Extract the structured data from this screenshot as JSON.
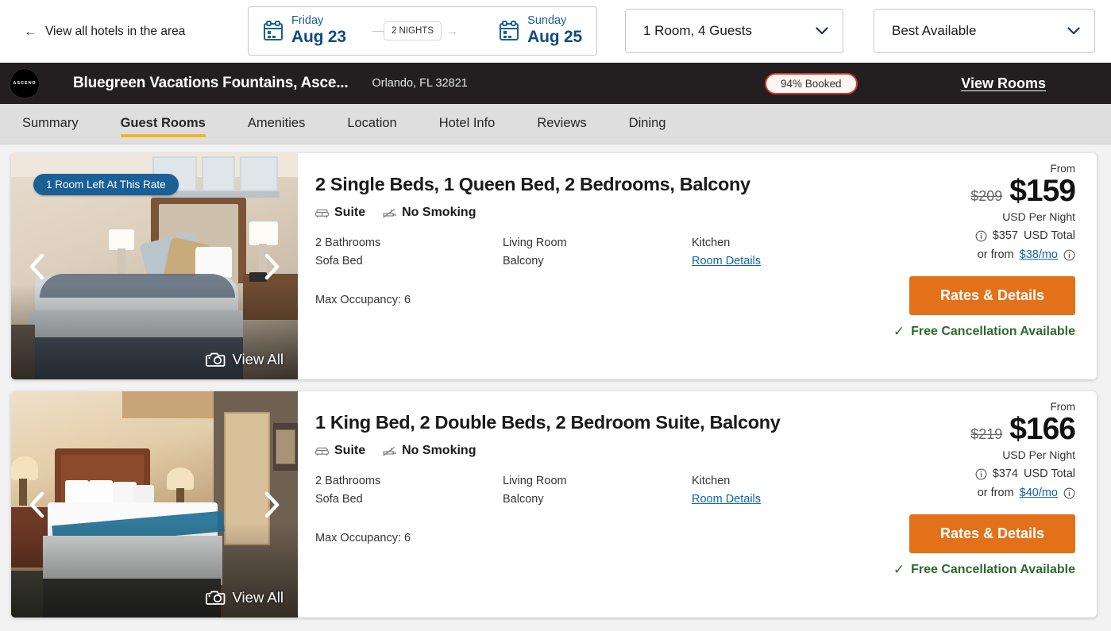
{
  "topbar": {
    "back_label": "View all hotels in the area",
    "back_icon": "arrow-left-icon",
    "checkin": {
      "dow": "Friday",
      "date": "Aug 23",
      "icon": "calendar-icon"
    },
    "checkout": {
      "dow": "Sunday",
      "date": "Aug 25",
      "icon": "calendar-icon"
    },
    "nights": "2 NIGHTS",
    "guests_value": "1 Room, 4 Guests",
    "rate_value": "Best Available",
    "chevron_icon": "chevron-down-icon"
  },
  "hotel": {
    "logo_text": "ASCEND",
    "name": "Bluegreen Vacations Fountains, Asce...",
    "location": "Orlando, FL 32821",
    "booked_badge": "94% Booked",
    "view_rooms": "View Rooms",
    "accent_orange": "#e2711a",
    "badge_border": "#d3392a",
    "tab_underline": "#f5b325"
  },
  "tabs": [
    {
      "label": "Summary",
      "active": false
    },
    {
      "label": "Guest Rooms",
      "active": true
    },
    {
      "label": "Amenities",
      "active": false
    },
    {
      "label": "Location",
      "active": false
    },
    {
      "label": "Hotel Info",
      "active": false
    },
    {
      "label": "Reviews",
      "active": false
    },
    {
      "label": "Dining",
      "active": false
    }
  ],
  "common": {
    "view_all": "View All",
    "camera_icon": "camera-icon",
    "prev_icon": "chevron-left-icon",
    "next_icon": "chevron-right-icon",
    "suite_icon": "sofa-icon",
    "smoking_icon": "no-smoking-icon",
    "info_icon": "info-circle-icon",
    "check_icon": "check-icon",
    "from_label": "From",
    "per_night": "USD Per Night",
    "usd_total_suffix": "USD Total",
    "or_from": "or from",
    "cta_label": "Rates & Details",
    "free_cancellation": "Free Cancellation Available",
    "room_details": "Room Details",
    "suite_label": "Suite",
    "no_smoking_label": "No Smoking"
  },
  "rooms": [
    {
      "badge": "1 Room Left At This Rate",
      "title": "2 Single Beds, 1 Queen Bed, 2 Bedrooms, Balcony",
      "features": [
        "2 Bathrooms",
        "Living Room",
        "Kitchen",
        "Sofa Bed",
        "Balcony"
      ],
      "max_occupancy": "Max Occupancy: 6",
      "price_old": "$209",
      "price_new": "$159",
      "total": "$357",
      "monthly": "$38/mo"
    },
    {
      "badge": "",
      "title": "1 King Bed, 2 Double Beds, 2 Bedroom Suite, Balcony",
      "features": [
        "2 Bathrooms",
        "Living Room",
        "Kitchen",
        "Sofa Bed",
        "Balcony"
      ],
      "max_occupancy": "Max Occupancy: 6",
      "price_old": "$219",
      "price_new": "$166",
      "total": "$374",
      "monthly": "$40/mo"
    }
  ]
}
